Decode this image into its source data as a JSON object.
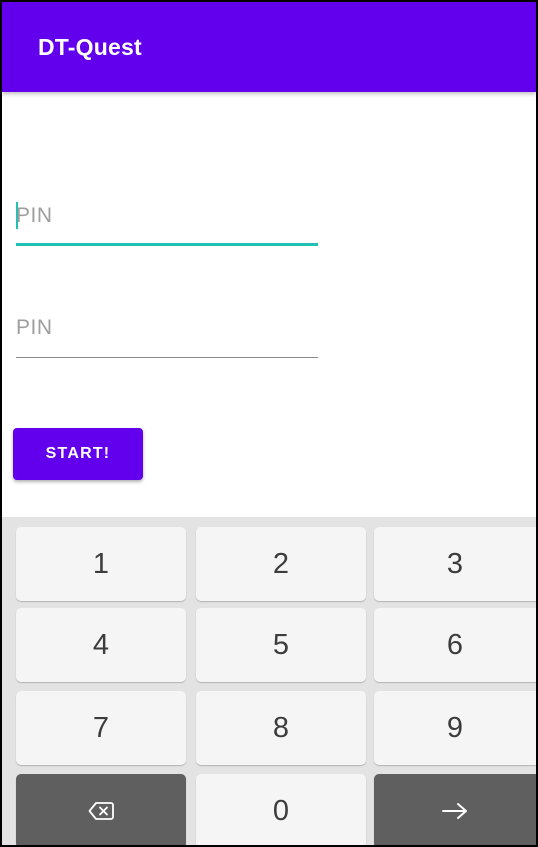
{
  "app_bar": {
    "title": "DT-Quest",
    "color": "#6200EE"
  },
  "form": {
    "fields": [
      {
        "placeholder": "PIN",
        "focused": true
      },
      {
        "placeholder": "PIN",
        "focused": false
      }
    ],
    "start_button_label": "START!"
  },
  "keyboard": {
    "keys": {
      "k1": "1",
      "k2": "2",
      "k3": "3",
      "k4": "4",
      "k5": "5",
      "k6": "6",
      "k7": "7",
      "k8": "8",
      "k9": "9",
      "k0": "0"
    },
    "backspace_icon": "backspace-icon",
    "enter_icon": "arrow-right-icon"
  },
  "colors": {
    "accent": "#20C1B4",
    "primary": "#6200EE",
    "key_background": "#f5f5f5",
    "key_dark": "#5f5f5f"
  }
}
